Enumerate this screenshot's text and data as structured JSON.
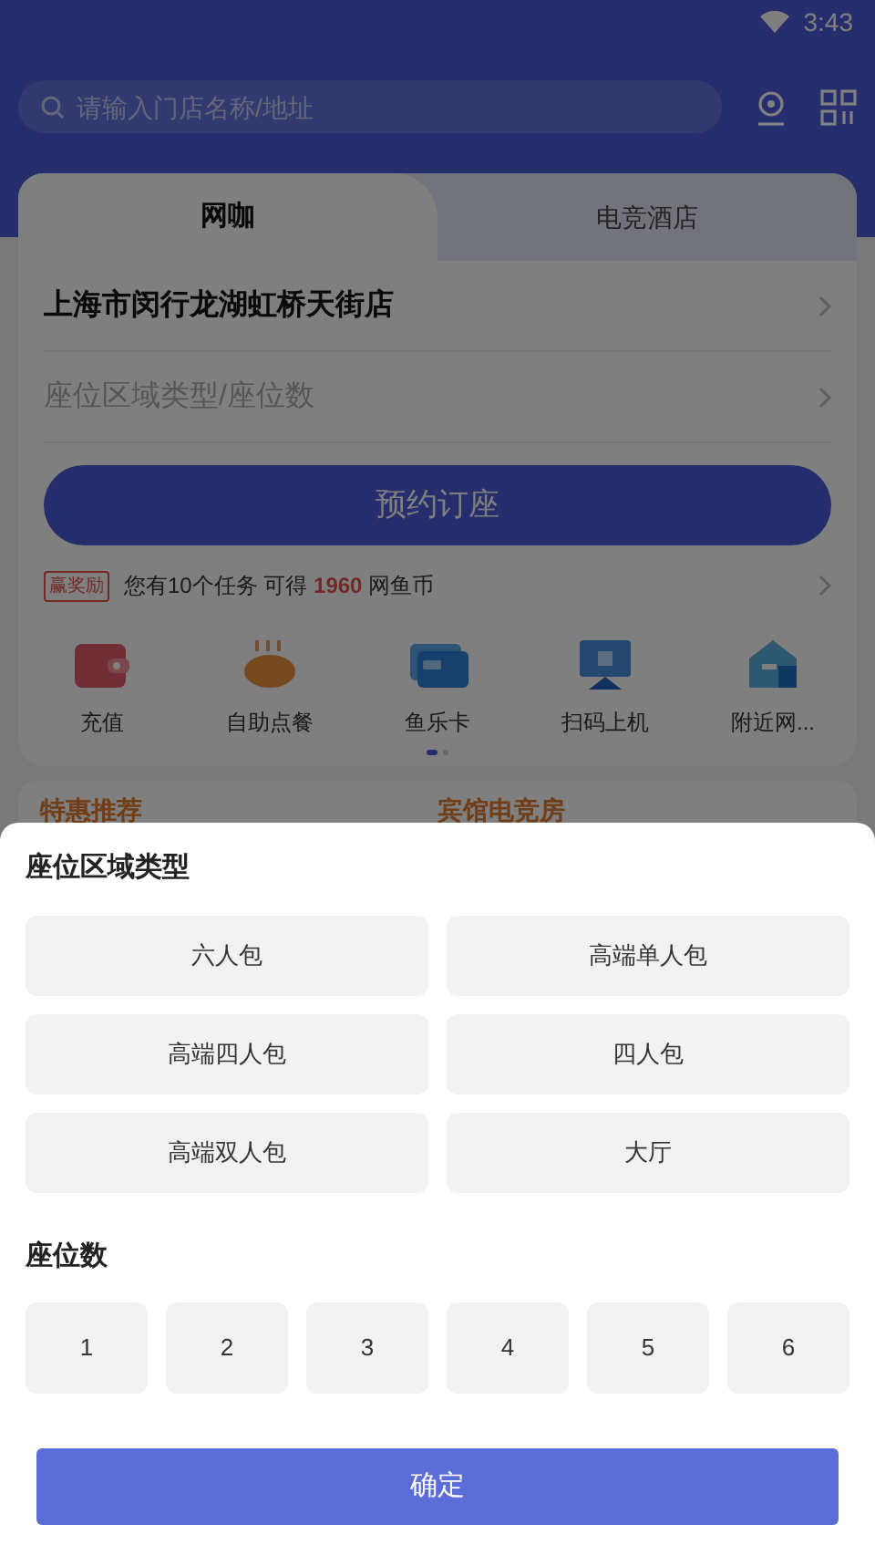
{
  "status_bar": {
    "time": "3:43"
  },
  "search": {
    "placeholder": "请输入门店名称/地址"
  },
  "tabs": [
    {
      "label": "网咖",
      "selected": true
    },
    {
      "label": "电竞酒店",
      "selected": false
    }
  ],
  "store": "上海市闵行龙湖虹桥天街店",
  "seat_field": {
    "placeholder": "座位区域类型/座位数"
  },
  "book_button": "预约订座",
  "task": {
    "badge": "赢奖励",
    "prefix": "您有10个任务 可得",
    "highlight": "1960",
    "suffix": "网鱼币"
  },
  "shortcuts": [
    {
      "label": "充值",
      "kind": "wallet"
    },
    {
      "label": "自助点餐",
      "kind": "food"
    },
    {
      "label": "鱼乐卡",
      "kind": "card"
    },
    {
      "label": "扫码上机",
      "kind": "monitor"
    },
    {
      "label": "附近网...",
      "kind": "building"
    }
  ],
  "pager": [
    {
      "selected": true
    },
    {
      "selected": false
    }
  ],
  "sections": [
    "特惠推荐",
    "宾馆电竞房"
  ],
  "sheet": {
    "area_title": "座位区域类型",
    "areas": [
      {
        "label": "六人包",
        "selected": false
      },
      {
        "label": "高端单人包",
        "selected": false
      },
      {
        "label": "高端四人包",
        "selected": false
      },
      {
        "label": "四人包",
        "selected": false
      },
      {
        "label": "高端双人包",
        "selected": false
      },
      {
        "label": "大厅",
        "selected": false
      }
    ],
    "count_title": "座位数",
    "counts": [
      {
        "label": "1",
        "selected": false
      },
      {
        "label": "2",
        "selected": false
      },
      {
        "label": "3",
        "selected": false
      },
      {
        "label": "4",
        "selected": false
      },
      {
        "label": "5",
        "selected": false
      },
      {
        "label": "6",
        "selected": false
      }
    ],
    "confirm_button": "确定"
  }
}
